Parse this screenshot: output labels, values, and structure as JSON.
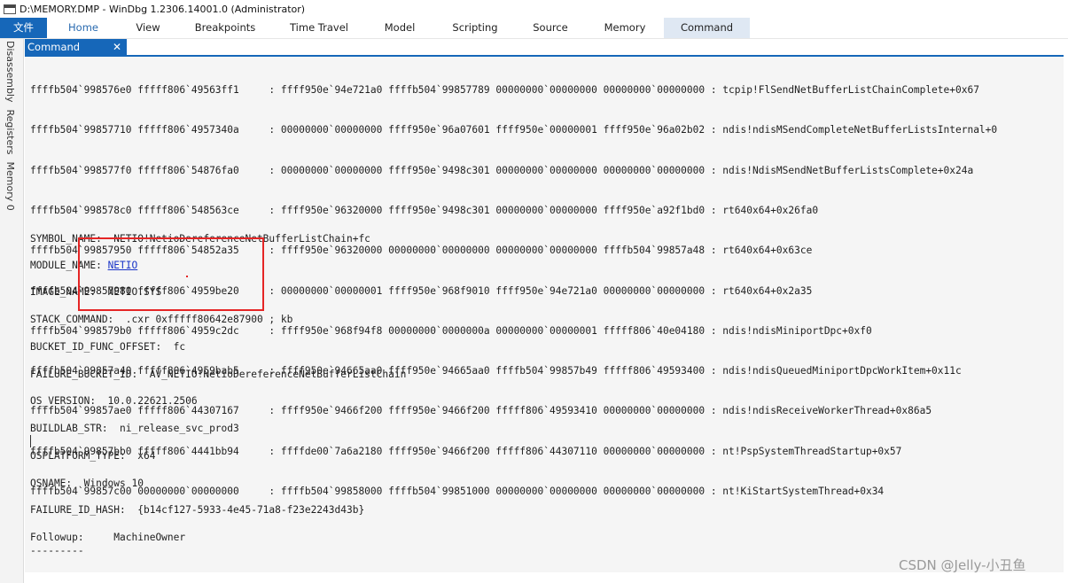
{
  "window": {
    "title": "D:\\MEMORY.DMP - WinDbg 1.2306.14001.0 (Administrator)",
    "app_icon": "windbg-app-icon"
  },
  "ribbon": {
    "file_label": "文件",
    "tabs": [
      "Home",
      "View",
      "Breakpoints",
      "Time Travel",
      "Model",
      "Scripting",
      "Source",
      "Memory",
      "Command"
    ],
    "selected_tab": "Command"
  },
  "side_panel": {
    "tabs": [
      "Disassembly",
      "Registers",
      "Memory 0"
    ]
  },
  "document_tab": {
    "label": "Command",
    "close_glyph": "✕"
  },
  "stack": [
    "ffffb504`998576e0 fffff806`49563ff1     : ffff950e`94e721a0 ffffb504`99857789 00000000`00000000 00000000`00000000 : tcpip!FlSendNetBufferListChainComplete+0x67",
    "ffffb504`99857710 fffff806`4957340a     : 00000000`00000000 ffff950e`96a07601 ffff950e`00000001 ffff950e`96a02b02 : ndis!ndisMSendCompleteNetBufferListsInternal+0",
    "ffffb504`998577f0 fffff806`54876fa0     : 00000000`00000000 ffff950e`9498c301 00000000`00000000 00000000`00000000 : ndis!NdisMSendNetBufferListsComplete+0x24a",
    "ffffb504`998578c0 fffff806`548563ce     : ffff950e`96320000 ffff950e`9498c301 00000000`00000000 ffff950e`a92f1bd0 : rt640x64+0x26fa0",
    "ffffb504`99857950 fffff806`54852a35     : ffff950e`96320000 00000000`00000000 00000000`00000000 ffffb504`99857a48 : rt640x64+0x63ce",
    "ffffb504`99857980 fffff806`4959be20     : 00000000`00000001 ffff950e`968f9010 ffff950e`94e721a0 00000000`00000000 : rt640x64+0x2a35",
    "ffffb504`998579b0 fffff806`4959c2dc     : ffff950e`968f94f8 00000000`0000000a 00000000`00000001 fffff806`40e04180 : ndis!ndisMiniportDpc+0xf0",
    "ffffb504`99857a40 fffff806`4959bab5     : ffff950e`94665aa0 ffff950e`94665aa0 ffffb504`99857b49 fffff806`49593400 : ndis!ndisQueuedMiniportDpcWorkItem+0x11c",
    "ffffb504`99857ae0 fffff806`44307167     : ffff950e`9466f200 ffff950e`9466f200 fffff806`49593410 00000000`00000000 : ndis!ndisReceiveWorkerThread+0x86a5",
    "ffffb504`99857bb0 fffff806`4441bb94     : ffffde00`7a6a2180 ffff950e`9466f200 fffff806`44307110 00000000`00000000 : nt!PspSystemThreadStartup+0x57",
    "ffffb504`99857c00 00000000`00000000     : ffffb504`99858000 ffffb504`99851000 00000000`00000000 00000000`00000000 : nt!KiStartSystemThread+0x34"
  ],
  "analysis": {
    "symbol_name": "SYMBOL_NAME:  NETIO!NetioDereferenceNetBufferListChain+fc",
    "module_name_label": "MODULE_NAME: ",
    "module_name_link": "NETIO",
    "image_name": "IMAGE_NAME:  NETIO.SYS",
    "stack_command": "STACK_COMMAND:  .cxr 0xfffff80642e87900 ; kb",
    "bucket_id_func_offset": "BUCKET_ID_FUNC_OFFSET:  fc",
    "failure_bucket_id": "FAILURE_BUCKET_ID:  AV_NETIO!NetioDereferenceNetBufferListChain",
    "os_version": "OS_VERSION:  10.0.22621.2506",
    "buildlab_str": "BUILDLAB_STR:  ni_release_svc_prod3",
    "osplatform_type": "OSPLATFORM_TYPE:  x64",
    "osname": "OSNAME:  Windows 10",
    "failure_id_hash": "FAILURE_ID_HASH:  {b14cf127-5933-4e45-71a8-f23e2243d43b}",
    "followup": "Followup:     MachineOwner",
    "separator": "---------"
  },
  "watermark": "CSDN @Jelly-小丑鱼",
  "colors": {
    "accent": "#1667b9",
    "highlight_box": "#e52525",
    "link": "#1a35c8",
    "output_bg": "#f5f5f5"
  }
}
